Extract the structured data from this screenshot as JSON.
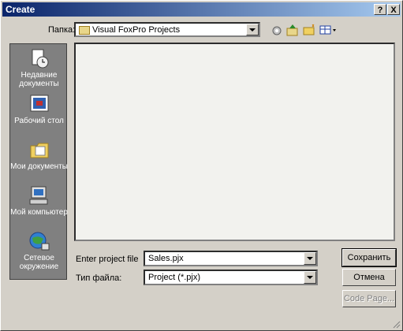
{
  "title": "Create",
  "title_buttons": {
    "help": "?",
    "close": "X"
  },
  "lookin": {
    "label": "Папка:",
    "value": "Visual FoxPro Projects"
  },
  "places": [
    {
      "label": "Недавние документы",
      "icon": "recent-documents-icon"
    },
    {
      "label": "Рабочий стол",
      "icon": "desktop-icon"
    },
    {
      "label": "Мои документы",
      "icon": "my-documents-icon"
    },
    {
      "label": "Мой компьютер",
      "icon": "my-computer-icon"
    },
    {
      "label": "Сетевое окружение",
      "icon": "network-icon"
    }
  ],
  "filename": {
    "label": "Enter project file",
    "value": "Sales.pjx"
  },
  "filetype": {
    "label": "Тип файла:",
    "value": "Project (*.pjx)"
  },
  "buttons": {
    "save": "Сохранить",
    "cancel": "Отмена",
    "code_page": "Code Page..."
  }
}
